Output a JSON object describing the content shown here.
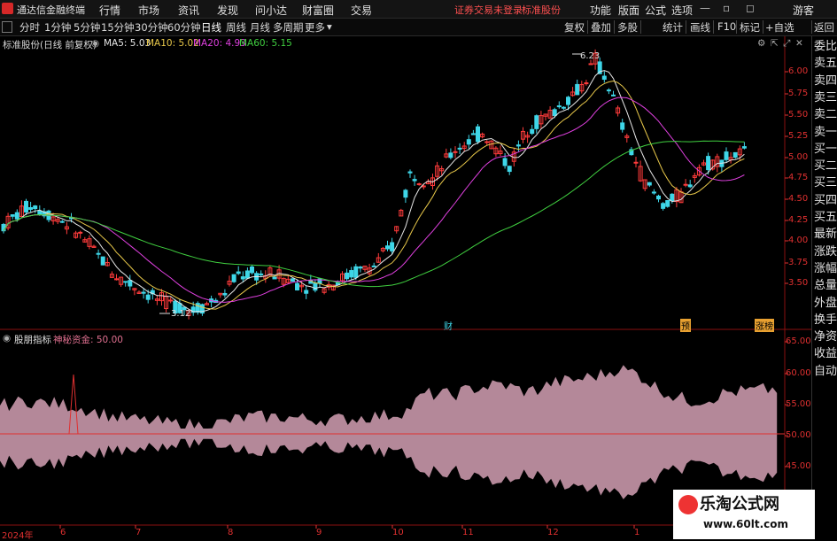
{
  "menubar": {
    "app_title": "通达信金融终端",
    "menus": [
      "行情",
      "市场",
      "资讯",
      "发现",
      "问小达",
      "财富圈",
      "交易"
    ],
    "status_text": "证券交易未登录",
    "stock_name_top": "标准股份",
    "right_menus": [
      "功能",
      "版面",
      "公式",
      "选项"
    ],
    "user": "游客"
  },
  "toolbar": {
    "periods": [
      "分时",
      "1分钟",
      "5分钟",
      "15分钟",
      "30分钟",
      "60分钟",
      "日线",
      "周线",
      "月线",
      "多周期",
      "更多"
    ],
    "active_period": "日线",
    "right_tools": [
      "复权",
      "叠加",
      "多股",
      "统计",
      "画线",
      "F10",
      "标记",
      "+自选",
      "返回"
    ]
  },
  "main_chart": {
    "stock_label": "标准股份(日线 前复权)",
    "ma": [
      {
        "label": "MA5: 5.03",
        "color": "#e6e6e6"
      },
      {
        "label": "MA10: 5.02",
        "color": "#e8c84a"
      },
      {
        "label": "MA20: 4.93",
        "color": "#e040e0"
      },
      {
        "label": "MA60: 5.15",
        "color": "#40d040"
      }
    ],
    "y_ticks": [
      "6.00",
      "5.75",
      "5.50",
      "5.25",
      "5.00",
      "4.75",
      "4.50",
      "4.25",
      "4.00",
      "3.75",
      "3.50"
    ],
    "high_label": "6.23",
    "low_label": "3.12",
    "event_labels": [
      "财",
      "预",
      "涨榜"
    ]
  },
  "sub_chart": {
    "indicator_name": "股朋指标",
    "series_label": "神秘资金: 50.00",
    "y_ticks": [
      "65.00",
      "60.00",
      "55.00",
      "50.00",
      "45.00"
    ]
  },
  "x_axis": {
    "labels": [
      "2024年",
      "6",
      "7",
      "8",
      "9",
      "10",
      "11",
      "12",
      "1"
    ]
  },
  "right_panel": {
    "items": [
      "委比",
      "卖五",
      "卖四",
      "卖三",
      "卖二",
      "卖一",
      "买一",
      "买二",
      "买三",
      "买四",
      "买五",
      "最新",
      "涨跌",
      "涨幅",
      "总量",
      "外盘",
      "换手",
      "净资",
      "收益",
      "自动"
    ]
  },
  "watermark": {
    "line1": "乐淘公式网",
    "line2": "www.60lt.com"
  },
  "colors": {
    "up": "#ff3b3b",
    "down": "#3ed6e8",
    "grid": "#8a1010",
    "area": "#d4a0b4"
  }
}
